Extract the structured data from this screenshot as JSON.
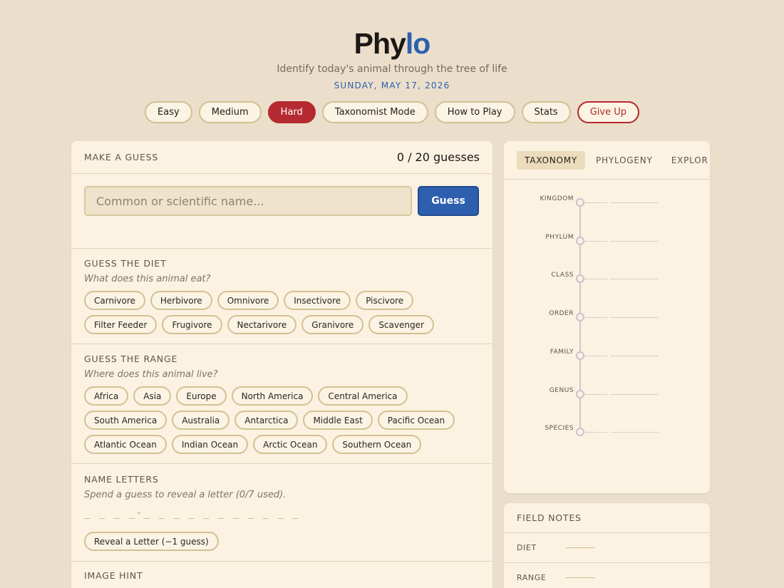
{
  "header": {
    "title_main": "Phy",
    "title_accent": "lo",
    "subtitle": "Identify today's animal through the tree of life",
    "date": "SUNDAY, MAY 17, 2026"
  },
  "modes": {
    "easy": "Easy",
    "medium": "Medium",
    "hard": "Hard",
    "taxonomist": "Taxonomist Mode",
    "how_to_play": "How to Play",
    "stats": "Stats",
    "give_up": "Give Up",
    "selected": "Hard"
  },
  "guess": {
    "title": "MAKE A GUESS",
    "count": "0 / 20 guesses",
    "placeholder": "Common or scientific name...",
    "button": "Guess"
  },
  "diet": {
    "title": "GUESS THE DIET",
    "hint": "What does this animal eat?",
    "options": [
      "Carnivore",
      "Herbivore",
      "Omnivore",
      "Insectivore",
      "Piscivore",
      "Filter Feeder",
      "Frugivore",
      "Nectarivore",
      "Granivore",
      "Scavenger"
    ]
  },
  "range": {
    "title": "GUESS THE RANGE",
    "hint": "Where does this animal live?",
    "options": [
      "Africa",
      "Asia",
      "Europe",
      "North America",
      "Central America",
      "South America",
      "Australia",
      "Antarctica",
      "Middle East",
      "Pacific Ocean",
      "Atlantic Ocean",
      "Indian Ocean",
      "Arctic Ocean",
      "Southern Ocean"
    ]
  },
  "letters": {
    "title": "NAME LETTERS",
    "hint": "Spend a guess to reveal a letter (0/7 used).",
    "pattern": "_ _ _ _-_ _ _ _ _ _  _ _ _ _ _",
    "button": "Reveal a Letter (−1 guess)"
  },
  "image_hint": {
    "title": "IMAGE HINT"
  },
  "right_tabs": {
    "taxonomy": "TAXONOMY",
    "phylogeny": "PHYLOGENY",
    "explore": "EXPLOR"
  },
  "taxonomy": {
    "ranks": [
      "KINGDOM",
      "PHYLUM",
      "CLASS",
      "ORDER",
      "FAMILY",
      "GENUS",
      "SPECIES"
    ]
  },
  "field_notes": {
    "title": "FIELD NOTES",
    "diet_label": "DIET",
    "range_label": "RANGE"
  },
  "colors": {
    "background": "#ebdfcb",
    "panel": "#fbf2e2",
    "accent_blue": "#2d5fae",
    "accent_red": "#b52a31",
    "chip_border": "#d3c194"
  }
}
